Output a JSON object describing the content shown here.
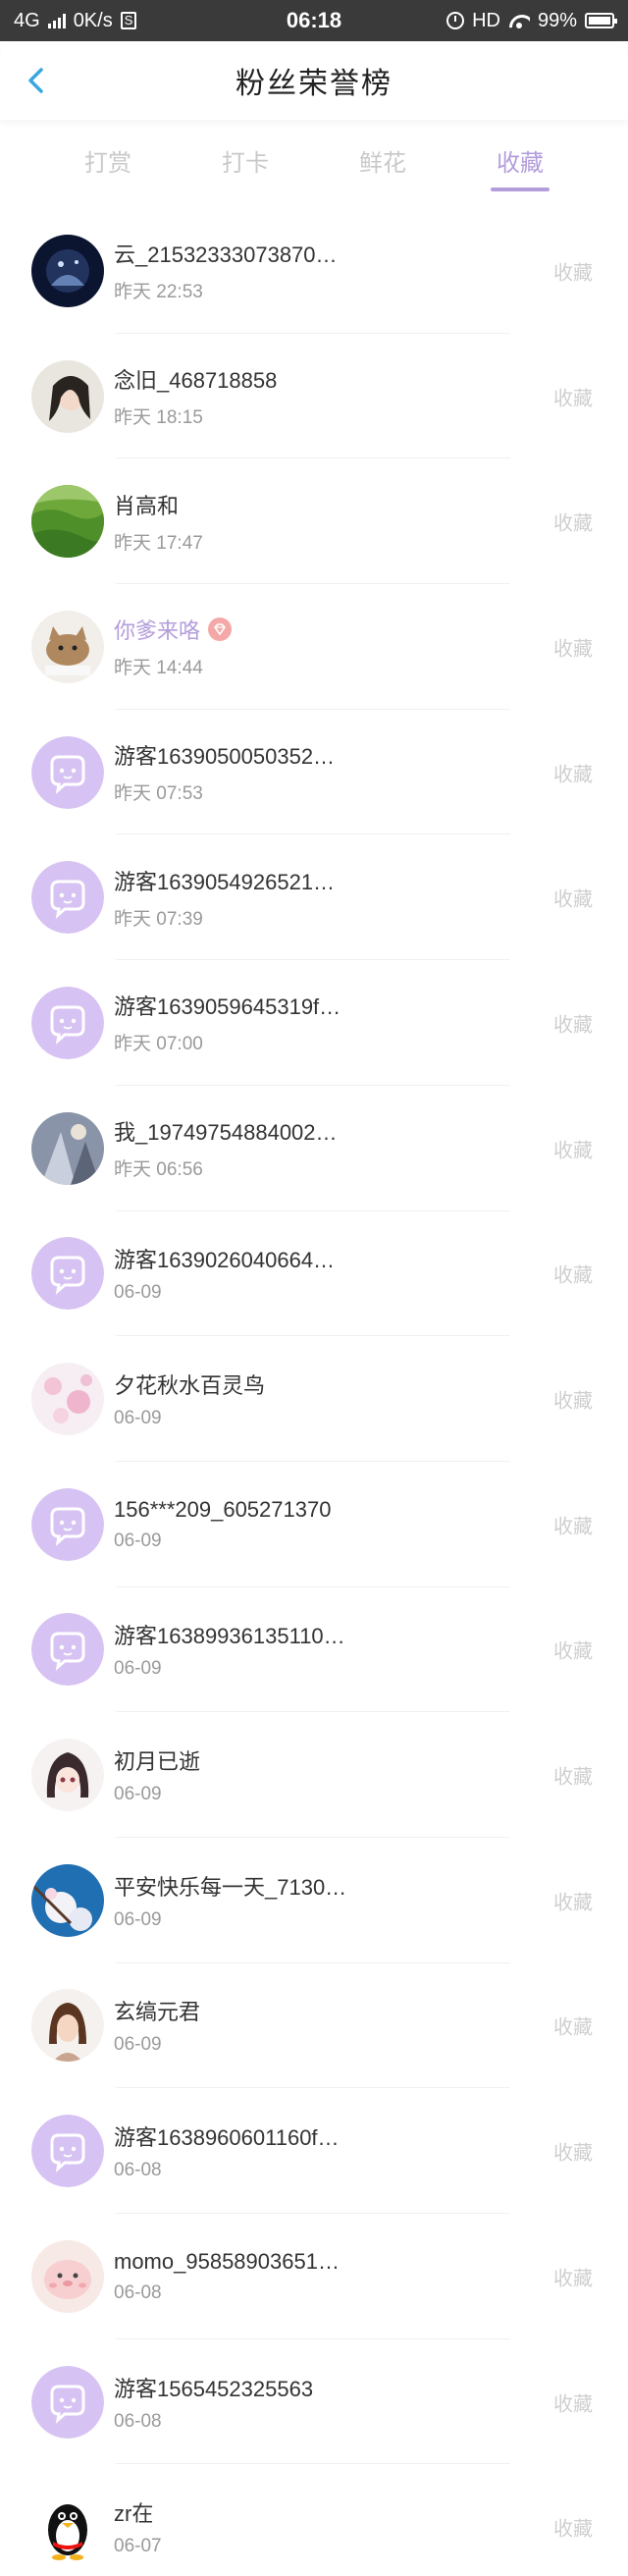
{
  "status_bar": {
    "network": "4G",
    "speed": "0K/s",
    "s_badge": "S",
    "time": "06:18",
    "hd": "HD",
    "battery": "99%"
  },
  "header": {
    "title": "粉丝荣誉榜"
  },
  "tabs": [
    {
      "label": "打赏",
      "active": false
    },
    {
      "label": "打卡",
      "active": false
    },
    {
      "label": "鲜花",
      "active": false
    },
    {
      "label": "收藏",
      "active": true
    }
  ],
  "colors": {
    "accent": "#b39ddb",
    "guest_avatar": "#d7c3f3",
    "vip_badge": "#f4a8a8"
  },
  "list": [
    {
      "name": "云_21532333073870…",
      "time": "昨天 22:53",
      "action": "收藏",
      "avatar": "night-photo"
    },
    {
      "name": "念旧_468718858",
      "time": "昨天 18:15",
      "action": "收藏",
      "avatar": "girl-photo"
    },
    {
      "name": "肖高和",
      "time": "昨天 17:47",
      "action": "收藏",
      "avatar": "green-landscape"
    },
    {
      "name": "你爹来咯",
      "time": "昨天 14:44",
      "action": "收藏",
      "avatar": "cat-cartoon",
      "vip": true
    },
    {
      "name": "游客1639050050352…",
      "time": "昨天 07:53",
      "action": "收藏",
      "avatar": "guest-chat-icon"
    },
    {
      "name": "游客1639054926521…",
      "time": "昨天 07:39",
      "action": "收藏",
      "avatar": "guest-chat-icon"
    },
    {
      "name": "游客1639059645319f…",
      "time": "昨天 07:00",
      "action": "收藏",
      "avatar": "guest-chat-icon"
    },
    {
      "name": "我_19749754884002…",
      "time": "昨天 06:56",
      "action": "收藏",
      "avatar": "anime-photo"
    },
    {
      "name": "游客1639026040664…",
      "time": "06-09",
      "action": "收藏",
      "avatar": "guest-chat-icon"
    },
    {
      "name": "夕花秋水百灵鸟",
      "time": "06-09",
      "action": "收藏",
      "avatar": "pink-flowers"
    },
    {
      "name": "156***209_605271370",
      "time": "06-09",
      "action": "收藏",
      "avatar": "guest-chat-icon"
    },
    {
      "name": "游客16389936135110…",
      "time": "06-09",
      "action": "收藏",
      "avatar": "guest-chat-icon"
    },
    {
      "name": "初月已逝",
      "time": "06-09",
      "action": "收藏",
      "avatar": "anime-girl"
    },
    {
      "name": "平安快乐每一天_7130…",
      "time": "06-09",
      "action": "收藏",
      "avatar": "blossom-sky"
    },
    {
      "name": "玄缟元君",
      "time": "06-09",
      "action": "收藏",
      "avatar": "woman-portrait"
    },
    {
      "name": "游客1638960601160f…",
      "time": "06-08",
      "action": "收藏",
      "avatar": "guest-chat-icon"
    },
    {
      "name": "momo_95858903651…",
      "time": "06-08",
      "action": "收藏",
      "avatar": "seal-cartoon"
    },
    {
      "name": "游客1565452325563",
      "time": "06-08",
      "action": "收藏",
      "avatar": "guest-chat-icon"
    },
    {
      "name": "zr在",
      "time": "06-07",
      "action": "收藏",
      "avatar": "penguin"
    }
  ]
}
